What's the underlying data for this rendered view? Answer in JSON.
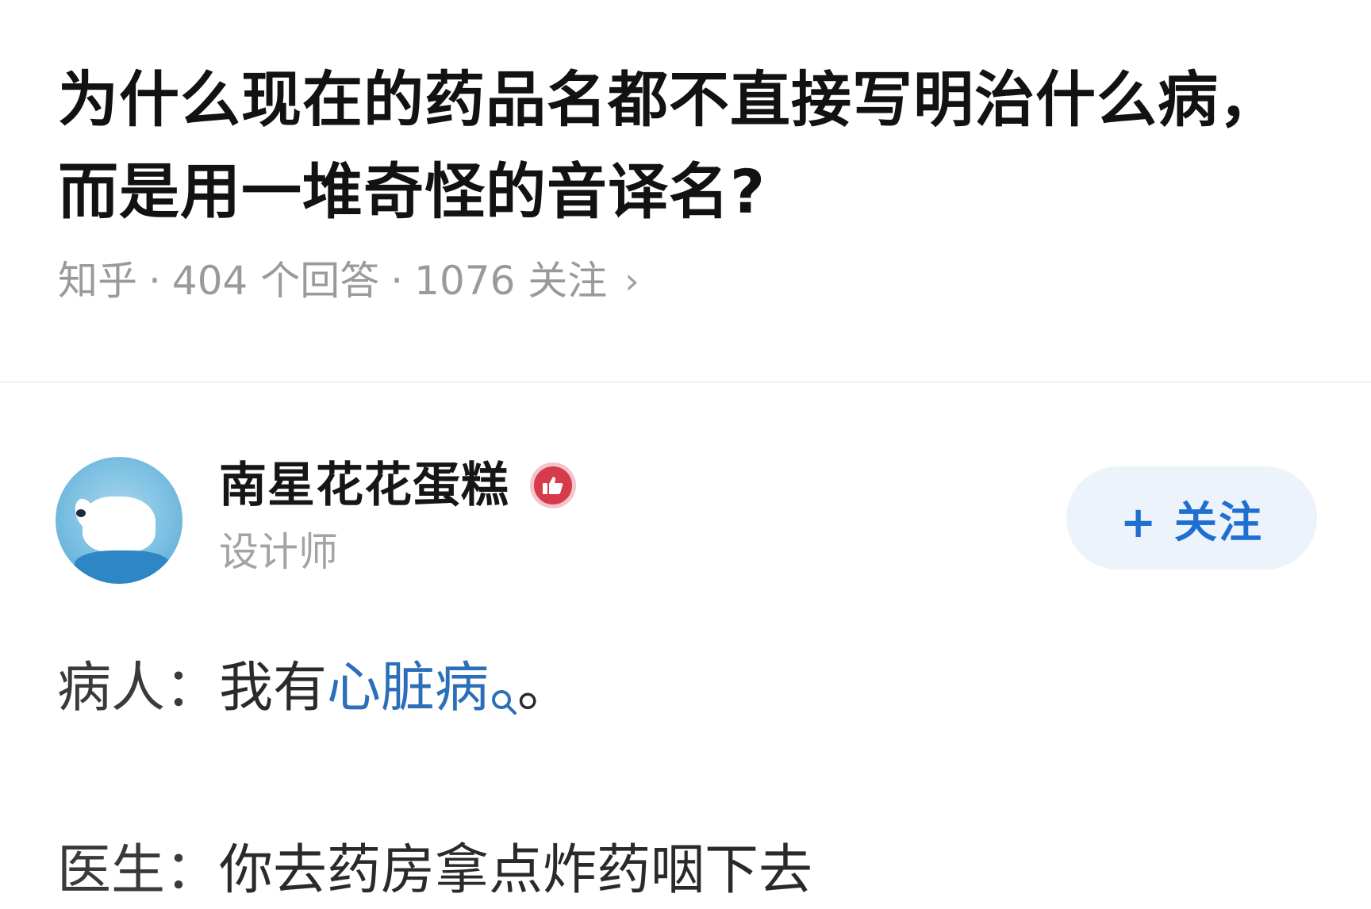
{
  "question": {
    "title": "为什么现在的药品名都不直接写明治什么病，而是用一堆奇怪的音译名?",
    "source": "知乎",
    "answers": "404 个回答",
    "followers": "1076 关注",
    "chevron": "›"
  },
  "author": {
    "name": "南星花花蛋糕",
    "badge_icon": "thumbs-up-badge-icon",
    "title": "设计师",
    "follow_label": "+ 关注"
  },
  "content": {
    "line1_label": "病人：",
    "line1_text": "我有",
    "line1_link": "心脏病",
    "line1_end": "。",
    "line2_label": "医生：",
    "line2_text": "你去药房拿点炸药咽下去"
  },
  "colors": {
    "link": "#2b6fb8",
    "follow_bg": "#edf3fb",
    "follow_text": "#1e6fcf",
    "badge": "#d73a4a",
    "meta": "#9a9a9a"
  }
}
